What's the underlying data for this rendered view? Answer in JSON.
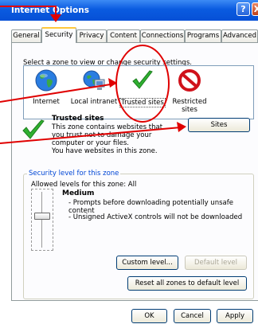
{
  "window": {
    "title": "Internet Options",
    "help_label": "?",
    "close_label": "X"
  },
  "tabs": [
    {
      "label": "General"
    },
    {
      "label": "Security"
    },
    {
      "label": "Privacy"
    },
    {
      "label": "Content"
    },
    {
      "label": "Connections"
    },
    {
      "label": "Programs"
    },
    {
      "label": "Advanced"
    }
  ],
  "zones": {
    "prompt": "Select a zone to view or change security settings.",
    "items": [
      {
        "label": "Internet",
        "icon": "globe-icon"
      },
      {
        "label": "Local intranet",
        "icon": "intranet-icon"
      },
      {
        "label": "Trusted sites",
        "icon": "green-check-icon"
      },
      {
        "label": "Restricted sites",
        "icon": "restricted-icon"
      }
    ]
  },
  "selected_zone": {
    "title": "Trusted sites",
    "description": "This zone contains websites that you trust not to damage your computer or your files.",
    "status": "You have websites in this zone.",
    "sites_button": "Sites"
  },
  "security_level": {
    "group_label": "Security level for this zone",
    "allowed_label": "Allowed levels for this zone: All",
    "level_name": "Medium",
    "bullets": [
      "- Prompts before downloading potentially unsafe content",
      "- Unsigned ActiveX controls will not be downloaded"
    ],
    "custom_button": "Custom level...",
    "default_button": "Default level",
    "reset_button": "Reset all zones to default level"
  },
  "footer": {
    "ok": "OK",
    "cancel": "Cancel",
    "apply": "Apply"
  },
  "colors": {
    "title_bar": "#0650d6",
    "annotation": "#e00000",
    "accent_tab": "#ffc83c"
  }
}
